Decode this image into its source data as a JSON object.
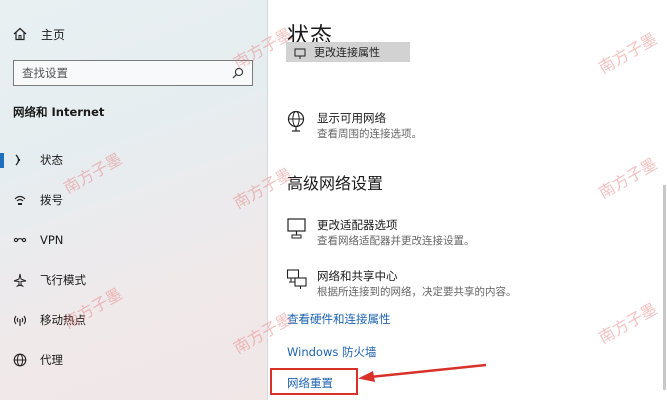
{
  "sidebar": {
    "home_label": "主页",
    "search_placeholder": "查找设置",
    "section_title": "网络和 Internet",
    "items": [
      {
        "label": "状态",
        "icon": "status-icon",
        "active": true
      },
      {
        "label": "拨号",
        "icon": "dialup-icon"
      },
      {
        "label": "VPN",
        "icon": "vpn-icon"
      },
      {
        "label": "飞行模式",
        "icon": "airplane-icon"
      },
      {
        "label": "移动热点",
        "icon": "hotspot-icon"
      },
      {
        "label": "代理",
        "icon": "globe-icon"
      }
    ]
  },
  "main": {
    "title": "状态",
    "partial_button_label": "更改连接属性",
    "show_networks": {
      "title": "显示可用网络",
      "desc": "查看周围的连接选项。"
    },
    "advanced_heading": "高级网络设置",
    "adapter_options": {
      "title": "更改适配器选项",
      "desc": "查看网络适配器并更改连接设置。"
    },
    "sharing_center": {
      "title": "网络和共享中心",
      "desc": "根据所连接到的网络，决定要共享的内容。"
    },
    "links": {
      "hardware": "查看硬件和连接属性",
      "firewall": "Windows 防火墙",
      "reset": "网络重置"
    }
  },
  "watermark_text": "南方子墨",
  "colors": {
    "accent": "#1e6fbf",
    "link": "#1e63b0",
    "annotation": "#d8312a"
  }
}
